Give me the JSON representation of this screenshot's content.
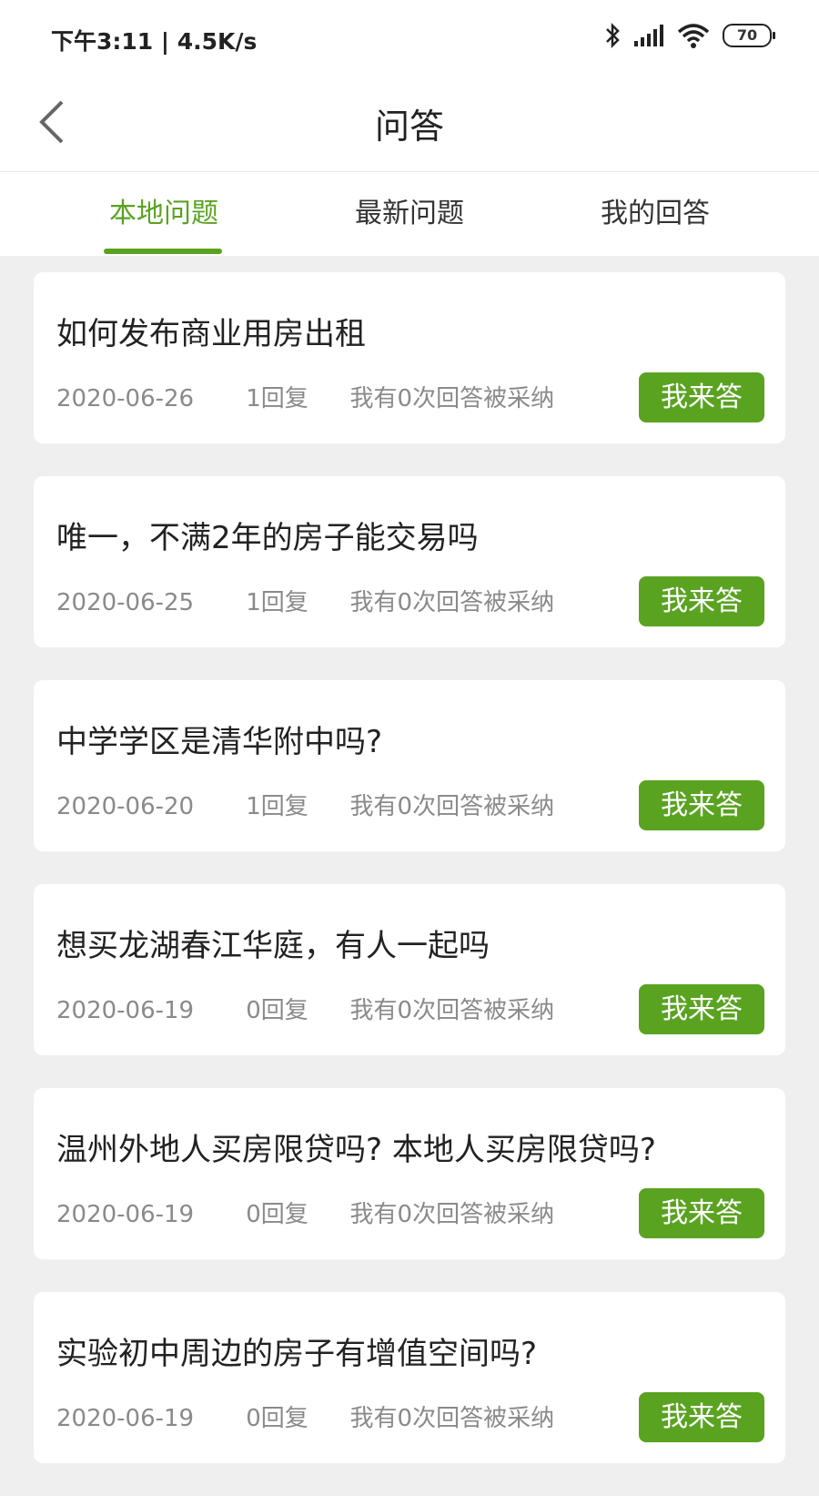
{
  "status_bar": {
    "time_speed": "下午3:11 | 4.5K/s",
    "battery": "70",
    "icons": [
      "bluetooth-icon",
      "signal-icon",
      "wifi-icon",
      "battery-icon"
    ]
  },
  "header": {
    "title": "问答"
  },
  "tabs": [
    {
      "label": "本地问题",
      "active": true
    },
    {
      "label": "最新问题",
      "active": false
    },
    {
      "label": "我的回答",
      "active": false
    }
  ],
  "colors": {
    "accent": "#5aa321",
    "background": "#efefef"
  },
  "questions": [
    {
      "title": "如何发布商业用房出租",
      "date": "2020-06-26",
      "replies": "1回复",
      "adopted": "我有0次回答被采纳",
      "button": "我来答"
    },
    {
      "title": "唯一，不满2年的房子能交易吗",
      "date": "2020-06-25",
      "replies": "1回复",
      "adopted": "我有0次回答被采纳",
      "button": "我来答"
    },
    {
      "title": "中学学区是清华附中吗?",
      "date": "2020-06-20",
      "replies": "1回复",
      "adopted": "我有0次回答被采纳",
      "button": "我来答"
    },
    {
      "title": "想买龙湖春江华庭，有人一起吗",
      "date": "2020-06-19",
      "replies": "0回复",
      "adopted": "我有0次回答被采纳",
      "button": "我来答"
    },
    {
      "title": "温州外地人买房限贷吗? 本地人买房限贷吗?",
      "date": "2020-06-19",
      "replies": "0回复",
      "adopted": "我有0次回答被采纳",
      "button": "我来答"
    },
    {
      "title": "实验初中周边的房子有增值空间吗?",
      "date": "2020-06-19",
      "replies": "0回复",
      "adopted": "我有0次回答被采纳",
      "button": "我来答"
    }
  ]
}
